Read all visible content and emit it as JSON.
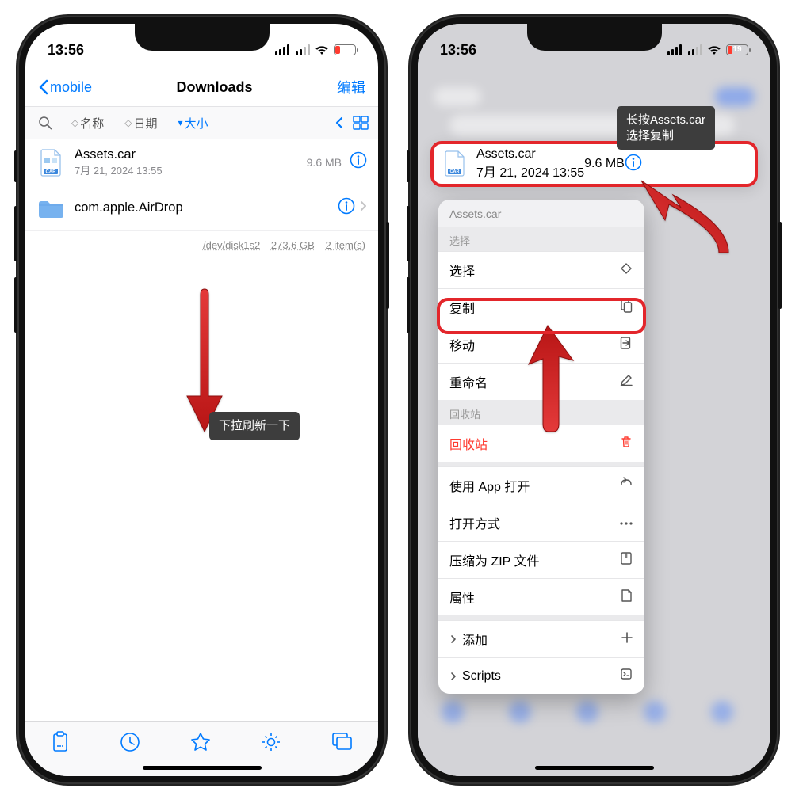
{
  "status": {
    "time": "13:56",
    "battery": "19"
  },
  "nav": {
    "back": "mobile",
    "title": "Downloads",
    "edit": "编辑"
  },
  "sortbar": {
    "name": "名称",
    "date": "日期",
    "size": "大小",
    "size_prefix": "▾"
  },
  "files": {
    "f0": {
      "name": "Assets.car",
      "sub": "7月 21, 2024 13:55",
      "size": "9.6 MB"
    },
    "f1": {
      "name": "com.apple.AirDrop"
    }
  },
  "statusline": {
    "disk": "/dev/disk1s2",
    "space": "273.6 GB",
    "count": "2 item(s)"
  },
  "tips": {
    "pull": "下拉刷新一下",
    "longpress": "长按Assets.car\n选择复制"
  },
  "context": {
    "title": "Assets.car",
    "sect_select": "选择",
    "select": "选择",
    "copy": "复制",
    "move": "移动",
    "rename": "重命名",
    "sect_trash": "回收站",
    "trash": "回收站",
    "open_app": "使用 App 打开",
    "open_with": "打开方式",
    "zip": "压缩为 ZIP 文件",
    "props": "属性",
    "add": "添加",
    "scripts": "Scripts"
  }
}
